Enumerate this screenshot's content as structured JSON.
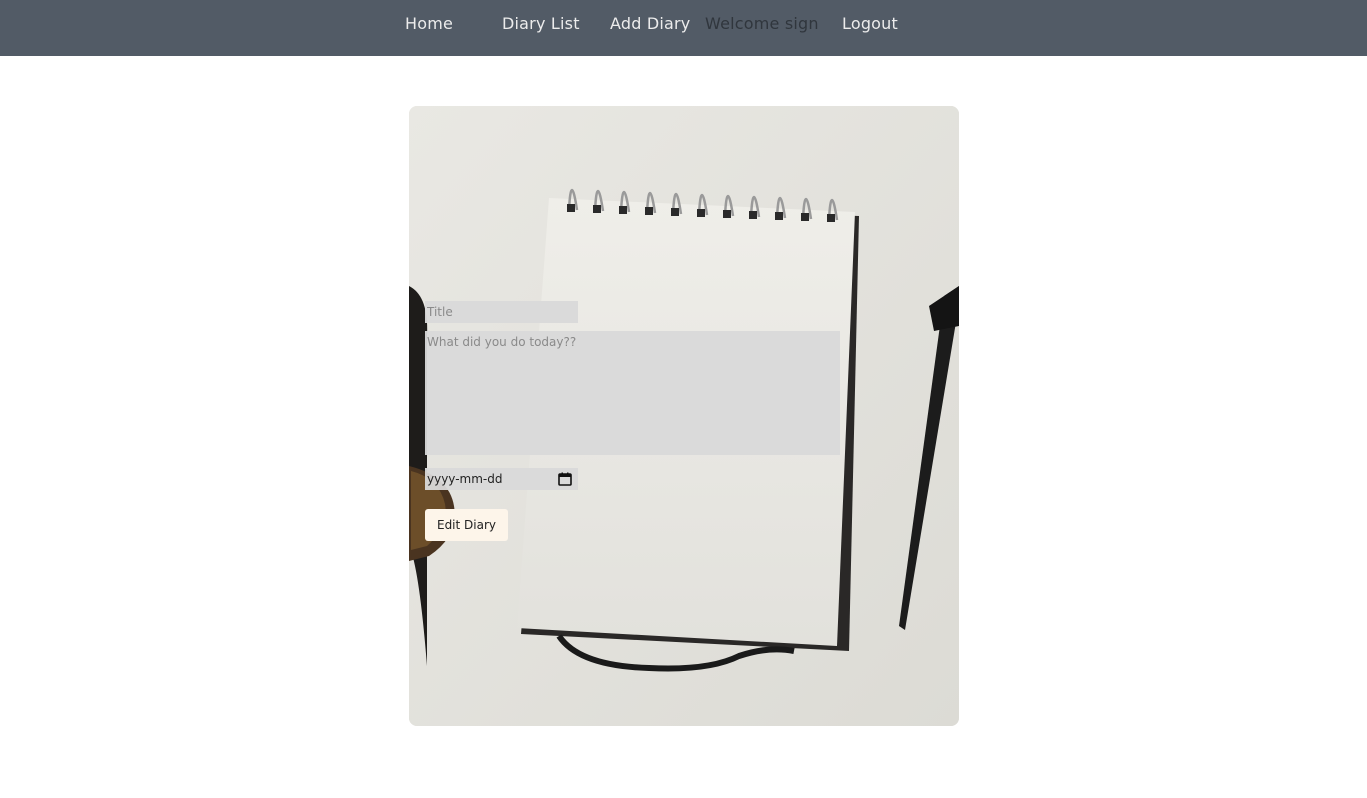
{
  "nav": {
    "home": "Home",
    "diary_list": "Diary List",
    "add_diary": "Add Diary",
    "welcome": "Welcome sign",
    "logout": "Logout"
  },
  "form": {
    "title_placeholder": "Title",
    "body_placeholder": "What did you do today??",
    "date_placeholder": "yyyy-mm-dd",
    "submit_label": "Edit Diary"
  },
  "icons": {
    "date_picker": "calendar-icon"
  },
  "colors": {
    "navbar_bg": "#525b66",
    "nav_text": "#ececec",
    "button_bg": "#fdf5ea",
    "field_bg": "#d9d9d9"
  }
}
